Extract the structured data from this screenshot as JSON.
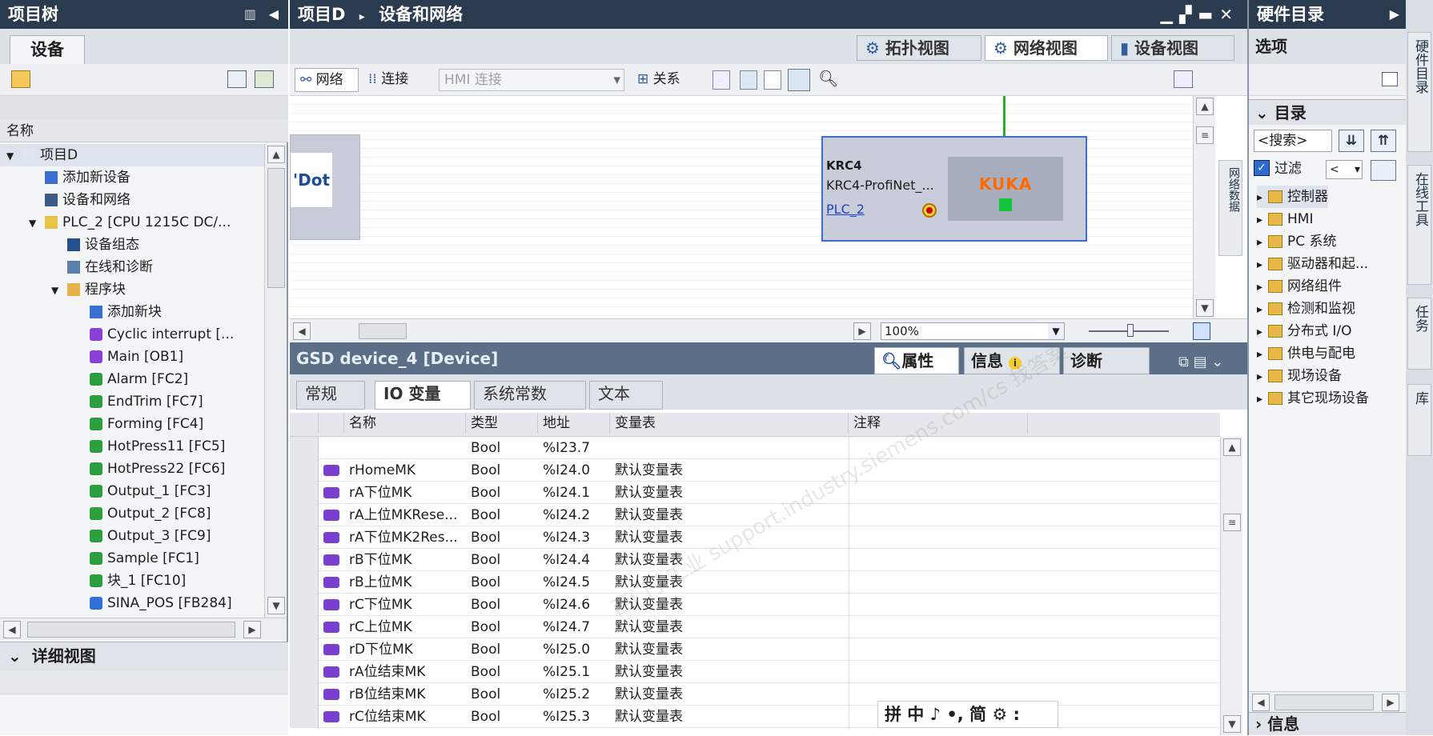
{
  "project_tree": {
    "title": "项目树",
    "device_tab": "设备",
    "column_name": "名称",
    "items": [
      {
        "label": "项目D",
        "indent": 0,
        "arrow": "▼",
        "icon": "doc"
      },
      {
        "label": "添加新设备",
        "indent": 1,
        "arrow": "",
        "icon": "add"
      },
      {
        "label": "设备和网络",
        "indent": 1,
        "arrow": "",
        "icon": "net"
      },
      {
        "label": "PLC_2 [CPU 1215C DC/...",
        "indent": 1,
        "arrow": "▼",
        "icon": "plc"
      },
      {
        "label": "设备组态",
        "indent": 2,
        "arrow": "",
        "icon": "cfg"
      },
      {
        "label": "在线和诊断",
        "indent": 2,
        "arrow": "",
        "icon": "diag"
      },
      {
        "label": "程序块",
        "indent": 2,
        "arrow": "▼",
        "icon": "folder"
      },
      {
        "label": "添加新块",
        "indent": 3,
        "arrow": "",
        "icon": "add"
      },
      {
        "label": "Cyclic interrupt [...",
        "indent": 3,
        "arrow": "",
        "icon": "ob"
      },
      {
        "label": "Main [OB1]",
        "indent": 3,
        "arrow": "",
        "icon": "ob"
      },
      {
        "label": "Alarm [FC2]",
        "indent": 3,
        "arrow": "",
        "icon": "fc"
      },
      {
        "label": "EndTrim [FC7]",
        "indent": 3,
        "arrow": "",
        "icon": "fc"
      },
      {
        "label": "Forming [FC4]",
        "indent": 3,
        "arrow": "",
        "icon": "fc"
      },
      {
        "label": "HotPress11 [FC5]",
        "indent": 3,
        "arrow": "",
        "icon": "fc"
      },
      {
        "label": "HotPress22 [FC6]",
        "indent": 3,
        "arrow": "",
        "icon": "fc"
      },
      {
        "label": "Output_1 [FC3]",
        "indent": 3,
        "arrow": "",
        "icon": "fc"
      },
      {
        "label": "Output_2 [FC8]",
        "indent": 3,
        "arrow": "",
        "icon": "fc"
      },
      {
        "label": "Output_3 [FC9]",
        "indent": 3,
        "arrow": "",
        "icon": "fc"
      },
      {
        "label": "Sample [FC1]",
        "indent": 3,
        "arrow": "",
        "icon": "fc"
      },
      {
        "label": "块_1 [FC10]",
        "indent": 3,
        "arrow": "",
        "icon": "fc"
      },
      {
        "label": "SINA_POS [FB284]",
        "indent": 3,
        "arrow": "",
        "icon": "fb"
      }
    ],
    "detail_view": "详细视图"
  },
  "editor": {
    "breadcrumb_project": "项目D",
    "breadcrumb_sep": "▸",
    "breadcrumb_page": "设备和网络",
    "view_tabs": [
      "拓扑视图",
      "网络视图",
      "设备视图"
    ],
    "toolbar": {
      "network": "网络",
      "connection": "连接",
      "connection_type": "HMI 连接",
      "relation": "关系"
    },
    "device": {
      "name": "KRC4",
      "type": "KRC4-ProfiNet_...",
      "plc_link": "PLC_2",
      "logo": "KUKA"
    },
    "left_device_fragment": "'Dot",
    "side_tab": "网络数据",
    "zoom": "100%"
  },
  "inspector": {
    "title": "GSD device_4 [Device]",
    "tabs_right": [
      "属性",
      "信息",
      "诊断"
    ],
    "tabs": [
      "常规",
      "IO 变量",
      "系统常数",
      "文本"
    ],
    "columns": [
      "名称",
      "类型",
      "地址",
      "变量表",
      "注释"
    ],
    "rows": [
      {
        "name": "",
        "type": "Bool",
        "addr": "%I23.7",
        "table": ""
      },
      {
        "name": "rHomeMK",
        "type": "Bool",
        "addr": "%I24.0",
        "table": "默认变量表"
      },
      {
        "name": "rA下位MK",
        "type": "Bool",
        "addr": "%I24.1",
        "table": "默认变量表"
      },
      {
        "name": "rA上位MKRese...",
        "type": "Bool",
        "addr": "%I24.2",
        "table": "默认变量表"
      },
      {
        "name": "rA下位MK2Res...",
        "type": "Bool",
        "addr": "%I24.3",
        "table": "默认变量表"
      },
      {
        "name": "rB下位MK",
        "type": "Bool",
        "addr": "%I24.4",
        "table": "默认变量表"
      },
      {
        "name": "rB上位MK",
        "type": "Bool",
        "addr": "%I24.5",
        "table": "默认变量表"
      },
      {
        "name": "rC下位MK",
        "type": "Bool",
        "addr": "%I24.6",
        "table": "默认变量表"
      },
      {
        "name": "rC上位MK",
        "type": "Bool",
        "addr": "%I24.7",
        "table": "默认变量表"
      },
      {
        "name": "rD下位MK",
        "type": "Bool",
        "addr": "%I25.0",
        "table": "默认变量表"
      },
      {
        "name": "rA位结束MK",
        "type": "Bool",
        "addr": "%I25.1",
        "table": "默认变量表"
      },
      {
        "name": "rB位结束MK",
        "type": "Bool",
        "addr": "%I25.2",
        "table": "默认变量表"
      },
      {
        "name": "rC位结束MK",
        "type": "Bool",
        "addr": "%I25.3",
        "table": "默认变量表"
      }
    ],
    "ime_bar": "拼 中 ♪ •, 简 ⚙ :"
  },
  "catalog": {
    "title": "硬件目录",
    "options": "选项",
    "section": "目录",
    "search_placeholder": "<搜索>",
    "filter_label": "过滤",
    "filter_value": "<",
    "items": [
      "控制器",
      "HMI",
      "PC 系统",
      "驱动器和起...",
      "网络组件",
      "检测和监视",
      "分布式 I/O",
      "供电与配电",
      "现场设备",
      "其它现场设备"
    ],
    "info_section": "信息"
  },
  "side_tabs": [
    "硬件目录",
    "在线工具",
    "任务",
    "库"
  ],
  "watermark": "西门子工业 support.industry.siemens.com/cs 找答案"
}
